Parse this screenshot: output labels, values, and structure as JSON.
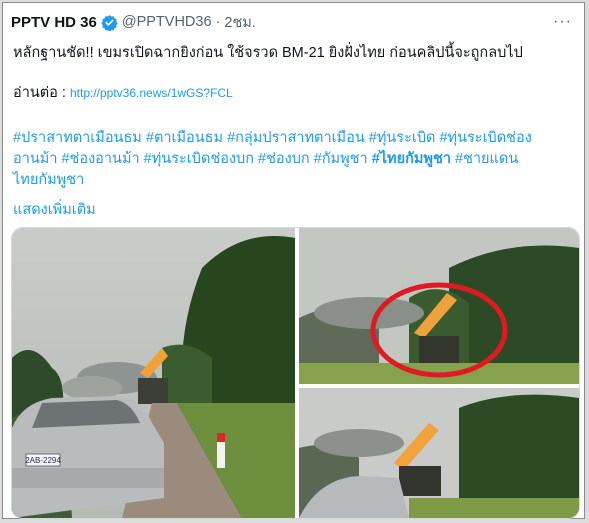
{
  "tweet": {
    "author_name": "PPTV HD 36",
    "handle": "@PPTVHD36",
    "separator": "·",
    "time": "2ชม.",
    "more_menu": "···",
    "headline": "หลักฐานชัด!! เขมรเปิดฉากยิงก่อน ใช้จรวด BM-21 ยิงฝั่งไทย ก่อนคลิปนี้จะถูกลบไป",
    "read_more_label": "อ่านต่อ :",
    "read_more_link": "http://pptv36.news/1wGS?FCL",
    "hashtags_line1": "#ปราสาทตาเมือนธม #ตาเมือนธม #กลุ่มปราสาทตาเมือน #ทุ่นระเบิด #ทุ่นระเบิดช่อง",
    "hashtags_line2_a": "อานม้า #ช่องอานม้า #ทุ่นระเบิดช่องบก #ช่องบก #กัมพูชา ",
    "hashtags_line2_bold": "#ไทยกัมพูชา",
    "hashtags_line2_b": " #ชายแดน",
    "hashtags_line3": "ไทยกัมพูชา",
    "show_more": "แสดงเพิ่มเติม"
  },
  "media": {
    "photo1": {
      "plate_text": "2AB-2294"
    }
  },
  "colors": {
    "link": "#1d9bf0",
    "verified": "#1d9bf0",
    "highlight_circle": "#e01a22"
  },
  "icons": [
    "verified-badge-icon",
    "more-options-icon"
  ]
}
